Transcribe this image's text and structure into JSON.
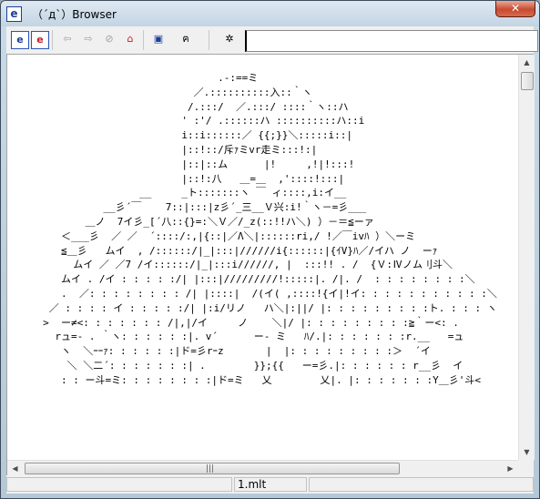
{
  "window": {
    "title": "（´д`）Browser",
    "close_label": "✕"
  },
  "toolbar": {
    "buttons": [
      {
        "icon": "e-icon",
        "glyph": "e"
      },
      {
        "icon": "e-red-icon",
        "glyph": "e"
      },
      {
        "icon": "back-icon",
        "glyph": "⇦"
      },
      {
        "icon": "forward-icon",
        "glyph": "⇨"
      },
      {
        "icon": "stop-icon",
        "glyph": "⊘"
      },
      {
        "icon": "home-icon",
        "glyph": "⌂"
      },
      {
        "icon": "windows-icon",
        "glyph": "▣"
      },
      {
        "icon": "cat-icon",
        "glyph": "ฅ"
      },
      {
        "icon": "settings-icon",
        "glyph": "✲"
      }
    ],
    "address_value": ""
  },
  "content": {
    "ascii_art": "                                  .-:==ミ\n                              ／.::::::::::入::｀ヽ\n                             /.:::/  ／.:::/ ::::｀ヽ::ハ\n                            ' :'/ .::::::ハ ::::::::::ハ::i\n                            i::i::::::／ {{;}}＼:::::i::|\n                            |::!::/斥ｧミvr走ミ:::!:|\n                            |::|::ム      |!     ,!|!:::!\n                            |::!:八   ＿=＿  ,'::::!:::|\n                     __     _ト:::::::ヽ ￣ ィ::::,i:イ__\n               __彡´￣    7::|:::|z彡´_三__Ｖ兴:i!｀ヽ－=彡___\n            ＿ノ  7イ彡_[´八::{}=:＼Ｖ／/_z(::!!ハ＼) ）－＝≦ーァ\n        ＜___彡  ／ ／  ´::::/:,|{::|／Λ＼|::::::ri,/ !／￣ivﾊ ）＼ーミ\n        ≦＿彡   ムイ  , /::::::/|_|:::|//////i{::::::|{ｲV}ﾊ／/イハ ノ  ーｧ\n          ムイ ／ ／7 /イ::::::/|_|:::i//////, |  :::!! . /  {Ｖ:Ⅳノム刂斗＼\n        ムイ . /イ : : : : :/| |:::|/////////!:::::|. /|. /  : : : : : : : :＼\n        .  ／: : : : : : : : /| |::::|  /(イ( ,::::!{イ|!イ: : : : : : : : : : :＼\n      ／ : : : : イ : : : : :/| |:i/リノ   ハ＼|:||/ |: : : : : : : : :ト. : : : ヽ\n     >  ー≠<: : : : : : : /|,|/イ     ノ    ＼|/ |: : : : : : : : :≧｀ー<: .\n       rュ=- . ｀ヽ: : : : : :|. v´      ー- ミ   ﾊ/.|: : : : : : :r.__   =ュ\n        ヽ  ＼ｰｰｧ: : : : : :|ド=彡rｰz       |  |: : : : : : : : :＞  ´イ\n         ＼ ＼二´: : : : : : :| .        }};{{   ー=彡.|: : : : : : r__彡  イ\n        : : ー斗=ミ: : : : : : : :|ド=ミ   乂        乂|. |: : : : : : :Y＿彡'斗<",
    "status_file": "1.mlt"
  }
}
